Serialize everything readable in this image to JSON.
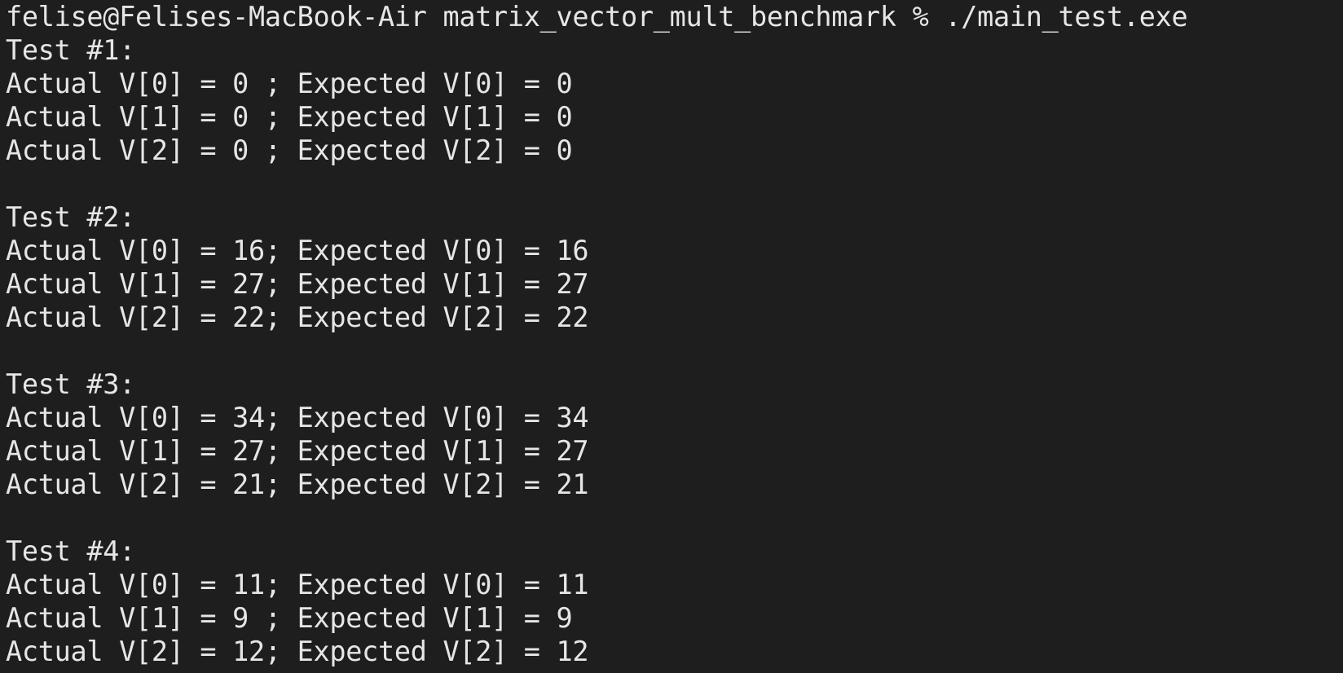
{
  "terminal": {
    "prompt": "felise@Felises-MacBook-Air matrix_vector_mult_benchmark % ./main_test.exe",
    "output": [
      "Test #1:",
      "Actual V[0] = 0 ; Expected V[0] = 0",
      "Actual V[1] = 0 ; Expected V[1] = 0",
      "Actual V[2] = 0 ; Expected V[2] = 0",
      "",
      "Test #2:",
      "Actual V[0] = 16; Expected V[0] = 16",
      "Actual V[1] = 27; Expected V[1] = 27",
      "Actual V[2] = 22; Expected V[2] = 22",
      "",
      "Test #3:",
      "Actual V[0] = 34; Expected V[0] = 34",
      "Actual V[1] = 27; Expected V[1] = 27",
      "Actual V[2] = 21; Expected V[2] = 21",
      "",
      "Test #4:",
      "Actual V[0] = 11; Expected V[0] = 11",
      "Actual V[1] = 9 ; Expected V[1] = 9",
      "Actual V[2] = 12; Expected V[2] = 12"
    ]
  },
  "colors": {
    "background": "#1e1e1e",
    "text": "#e6e6e6"
  }
}
